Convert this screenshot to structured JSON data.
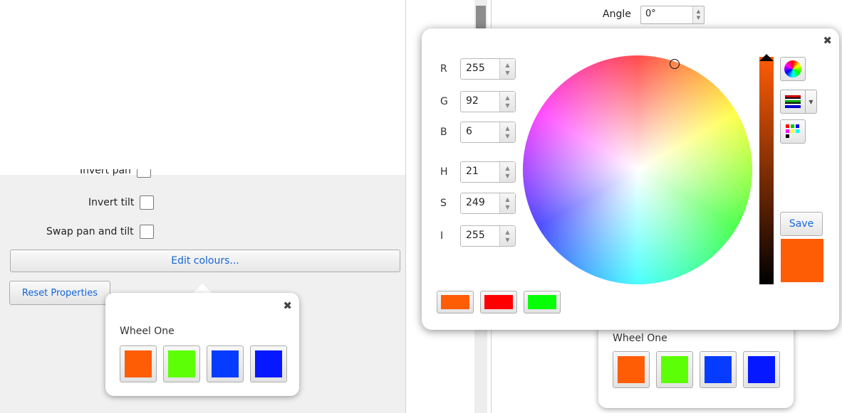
{
  "left_panel": {
    "invert_pan_label": "Invert pan",
    "invert_tilt_label": "Invert tilt",
    "swap_label": "Swap pan and tilt",
    "edit_colours_label": "Edit colours...",
    "reset_label": "Reset Properties"
  },
  "small_popup": {
    "title": "Wheel One",
    "close_glyph": "✖",
    "swatches": [
      "#ff5c06",
      "#5cff06",
      "#063cff",
      "#0618ff"
    ]
  },
  "right_bg": {
    "angle_label": "Angle",
    "angle_value": "0°"
  },
  "color_dialog": {
    "close_glyph": "✖",
    "channels": [
      {
        "label": "R",
        "value": "255"
      },
      {
        "label": "G",
        "value": "92"
      },
      {
        "label": "B",
        "value": "6"
      },
      {
        "label": "H",
        "value": "21"
      },
      {
        "label": "S",
        "value": "249"
      },
      {
        "label": "I",
        "value": "255"
      }
    ],
    "save_label": "Save",
    "current_color": "#ff5c06",
    "recent_colors": [
      "#ff5c06",
      "#ff0000",
      "#06ff06"
    ]
  },
  "bottom_popup": {
    "title": "Wheel One",
    "swatches": [
      "#ff5c06",
      "#5cff06",
      "#063cff",
      "#0618ff"
    ]
  }
}
